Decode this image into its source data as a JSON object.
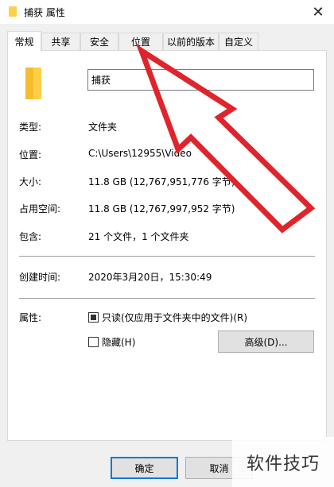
{
  "window": {
    "title": "捕获 属性",
    "close_glyph": "✕"
  },
  "tabs": [
    {
      "label": "常规",
      "active": true
    },
    {
      "label": "共享"
    },
    {
      "label": "安全"
    },
    {
      "label": "位置"
    },
    {
      "label": "以前的版本"
    },
    {
      "label": "自定义"
    }
  ],
  "general": {
    "name_value": "捕获",
    "type_label": "类型:",
    "type_value": "文件夹",
    "location_label": "位置:",
    "location_value": "C:\\Users\\12955\\Video",
    "size_label": "大小:",
    "size_value": "11.8 GB (12,767,951,776 字节)",
    "disk_size_label": "占用空间:",
    "disk_size_value": "11.8 GB (12,767,997,952 字节)",
    "contains_label": "包含:",
    "contains_value": "21 个文件，1 个文件夹",
    "created_label": "创建时间:",
    "created_value": "2020年3月20日，15:30:49",
    "attributes_label": "属性:",
    "readonly_label": "只读(仅应用于文件夹中的文件)(R)",
    "readonly_state": "indeterminate",
    "hidden_label": "隐藏(H)",
    "hidden_state": "unchecked",
    "advanced_button": "高级(D)..."
  },
  "footer": {
    "ok_label": "确定",
    "cancel_label": "取消"
  },
  "watermark": "软件技巧",
  "colors": {
    "arrow": "#e0242b",
    "folder": "#ffce47",
    "accent": "#0078d7"
  }
}
